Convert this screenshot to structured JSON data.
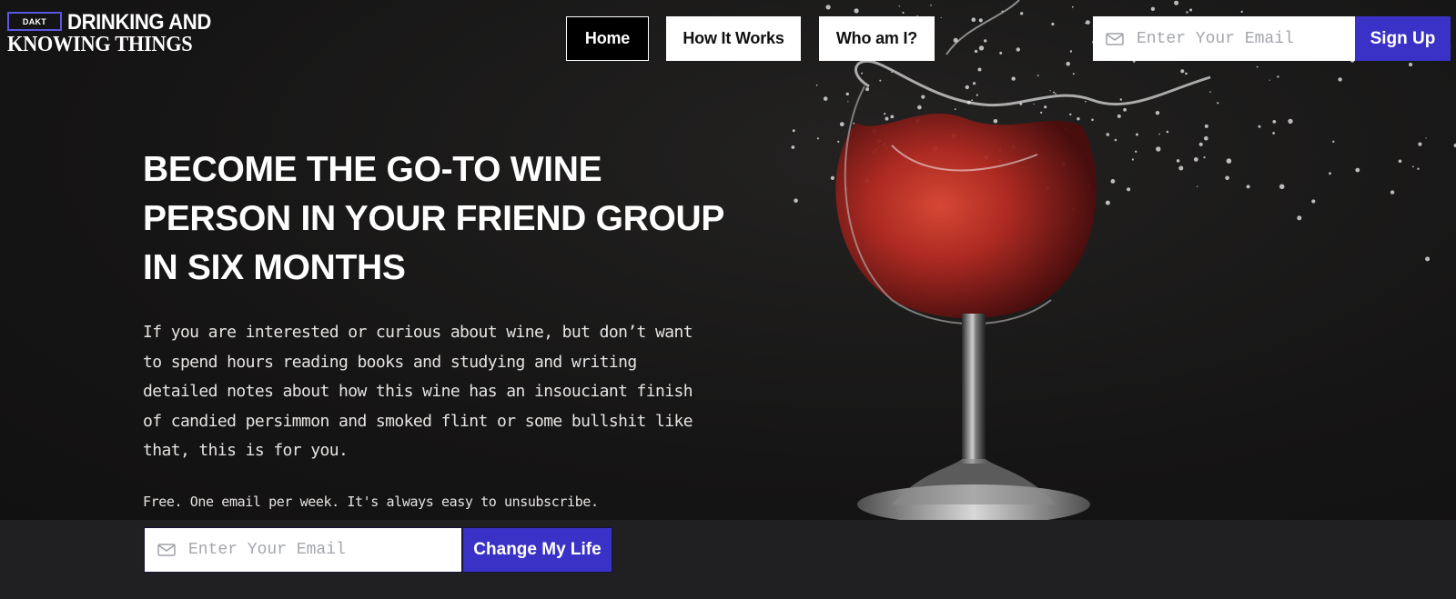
{
  "brand": {
    "badge": "DAKT",
    "name_line1": "DRINKING AND",
    "name_line2": "KNOWING THINGS"
  },
  "nav": {
    "items": [
      {
        "label": "Home",
        "active": true
      },
      {
        "label": "How It Works",
        "active": false
      },
      {
        "label": "Who am I?",
        "active": false
      }
    ]
  },
  "header_form": {
    "placeholder": "Enter Your Email",
    "button_label": "Sign Up",
    "icon": "mail-icon"
  },
  "hero": {
    "headline": "BECOME THE GO-TO WINE PERSON IN YOUR FRIEND GROUP IN SIX MONTHS",
    "intro": "If you are interested or curious about wine, but don’t want to spend hours reading books and studying and writing detailed notes about how this wine has an insouciant finish of candied persimmon and smoked flint or some bullshit like that, this is for you.",
    "fine_print": "Free. One email per week. It's always easy to unsubscribe.",
    "image": "red-wine-glass-splash"
  },
  "signup_form": {
    "placeholder": "Enter Your Email",
    "button_label": "Change My Life",
    "icon": "mail-icon"
  },
  "colors": {
    "accent": "#3a32c6",
    "background": "#161515",
    "band": "#201f21",
    "wine": "#a8241f"
  }
}
